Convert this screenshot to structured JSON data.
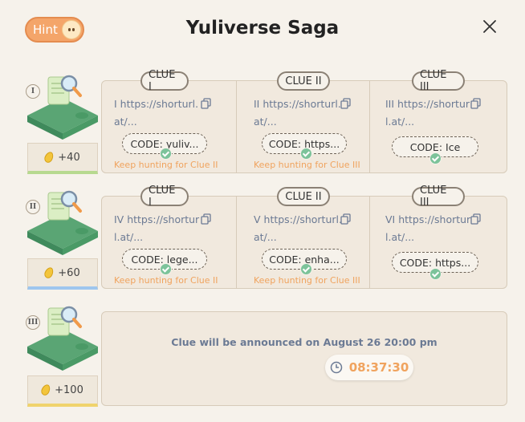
{
  "header": {
    "hint_label": "Hint",
    "title": "Yuliverse Saga"
  },
  "rows": [
    {
      "roman": "I",
      "reward": "+40",
      "clues": [
        {
          "tab": "CLUE I",
          "link": "I https://shorturl.at/...",
          "code": "CODE: yuliv...",
          "note": "Keep hunting for Clue II"
        },
        {
          "tab": "CLUE II",
          "link": "II https://shorturl.at/...",
          "code": "CODE: https...",
          "note": "Keep hunting for Clue III"
        },
        {
          "tab": "CLUE III",
          "link": "III https://shorturl.at/...",
          "code": "CODE: Ice",
          "note": ""
        }
      ]
    },
    {
      "roman": "II",
      "reward": "+60",
      "clues": [
        {
          "tab": "CLUE I",
          "link": "IV https://shorturl.at/...",
          "code": "CODE: lege...",
          "note": "Keep hunting for Clue II"
        },
        {
          "tab": "CLUE II",
          "link": "V https://shorturl.at/...",
          "code": "CODE: enha...",
          "note": "Keep hunting for Clue III"
        },
        {
          "tab": "CLUE III",
          "link": "VI https://shorturl.at/...",
          "code": "CODE: https...",
          "note": ""
        }
      ]
    },
    {
      "roman": "III",
      "reward": "+100",
      "announcement": "Clue will be announced on August 26 20:00 pm",
      "timer": "08:37:30"
    }
  ],
  "colors": {
    "accent_orange": "#f0a35e",
    "link_blue": "#6b7a94",
    "check_green": "#7cc39a"
  },
  "icons": [
    "close-icon",
    "copy-icon",
    "check-icon",
    "coin-icon",
    "clock-icon",
    "treasure-map-illustration"
  ]
}
